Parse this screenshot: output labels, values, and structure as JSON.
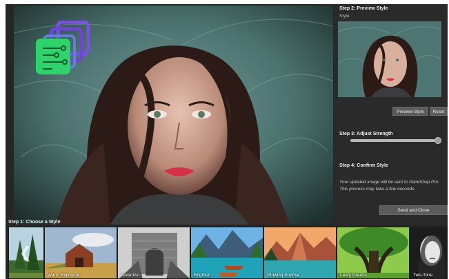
{
  "right_panel": {
    "step2": {
      "title": "Step 2: Preview Style",
      "style_label": "Style:"
    },
    "preview_button": "Preview Style",
    "reset_button": "Reset",
    "step3": {
      "title": "Step 3: Adjust Strength",
      "strength_fraction": 0.97
    },
    "step4": {
      "title": "Step 4: Confirm Style",
      "description": "Your updated image will be sent to PaintShop Pro. This process may take a few seconds."
    },
    "send_button": "Send and Close"
  },
  "filmstrip": {
    "title": "Step 1: Choose a Style",
    "scroll_left_icon": "chevron-left-icon",
    "thumbnails": [
      {
        "label": ""
      },
      {
        "label": "Warm Exposure"
      },
      {
        "label": "Texturize"
      },
      {
        "label": "Brighten"
      },
      {
        "label": "Glowing Sunrise"
      },
      {
        "label": "Leafy Greens"
      },
      {
        "label": "Two-Tone"
      }
    ]
  },
  "colors": {
    "app_background": "#262626",
    "button": "#5b5b5b",
    "logo_green": "#2ed36b",
    "logo_purple": "#7b4fe0"
  }
}
